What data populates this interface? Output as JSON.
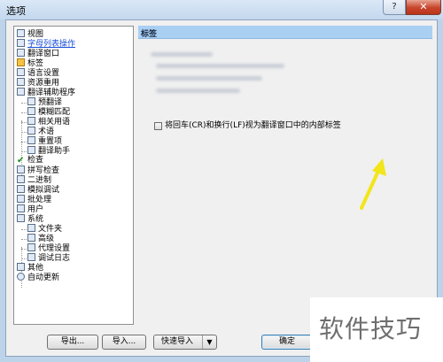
{
  "window": {
    "title": "选项",
    "help_glyph": "?",
    "close_glyph": "✕"
  },
  "tree": {
    "items": [
      {
        "label": "视图",
        "icon": "glasses-icon",
        "level": 0
      },
      {
        "label": "字母列表操作",
        "icon": "list-icon",
        "level": 0,
        "selected": true
      },
      {
        "label": "翻译窗口",
        "icon": "window-icon",
        "level": 0
      },
      {
        "label": "标签",
        "icon": "tag-icon",
        "level": 0
      },
      {
        "label": "语言设置",
        "icon": "language-icon",
        "level": 0
      },
      {
        "label": "资源重用",
        "icon": "resource-icon",
        "level": 0
      },
      {
        "label": "翻译辅助程序",
        "icon": "assistant-icon",
        "level": 0
      },
      {
        "label": "预翻译",
        "icon": "pretranslate-icon",
        "level": 1
      },
      {
        "label": "模糊匹配",
        "icon": "fuzzy-match-icon",
        "level": 1
      },
      {
        "label": "相关用语",
        "icon": "related-terms-icon",
        "level": 1
      },
      {
        "label": "术语",
        "icon": "terminology-icon",
        "level": 1
      },
      {
        "label": "重置项",
        "icon": "reset-icon",
        "level": 1
      },
      {
        "label": "翻译助手",
        "icon": "wand-icon",
        "level": 1
      },
      {
        "label": "检查",
        "icon": "check-icon",
        "level": 0
      },
      {
        "label": "拼写检查",
        "icon": "spellcheck-icon",
        "level": 0
      },
      {
        "label": "二进制",
        "icon": "binary-icon",
        "level": 0
      },
      {
        "label": "模拟调试",
        "icon": "debug-icon",
        "level": 0
      },
      {
        "label": "批处理",
        "icon": "batch-icon",
        "level": 0
      },
      {
        "label": "用户",
        "icon": "user-icon",
        "level": 0
      },
      {
        "label": "系统",
        "icon": "system-icon",
        "level": 0
      },
      {
        "label": "文件夹",
        "icon": "folder-icon",
        "level": 1
      },
      {
        "label": "高级",
        "icon": "advanced-icon",
        "level": 1
      },
      {
        "label": "代理设置",
        "icon": "proxy-icon",
        "level": 1
      },
      {
        "label": "调试日志",
        "icon": "log-icon",
        "level": 1
      },
      {
        "label": "其他",
        "icon": "other-icon",
        "level": 0
      },
      {
        "label": "自动更新",
        "icon": "update-icon",
        "level": 0
      }
    ]
  },
  "panel": {
    "title": "标签",
    "checkbox_label": "将回车(CR)和换行(LF)视为翻译窗口中的内部标签",
    "checkbox_checked": false
  },
  "buttons": {
    "export": "导出...",
    "import": "导入...",
    "quick_import": "快速导入",
    "quick_import_arrow": "▼",
    "ok": "确定"
  },
  "watermark": {
    "text": "软件技巧"
  },
  "colors": {
    "header_bg": "#a9cff3",
    "arrow": "#f2e51a",
    "selected_text": "#1a4fd6"
  }
}
